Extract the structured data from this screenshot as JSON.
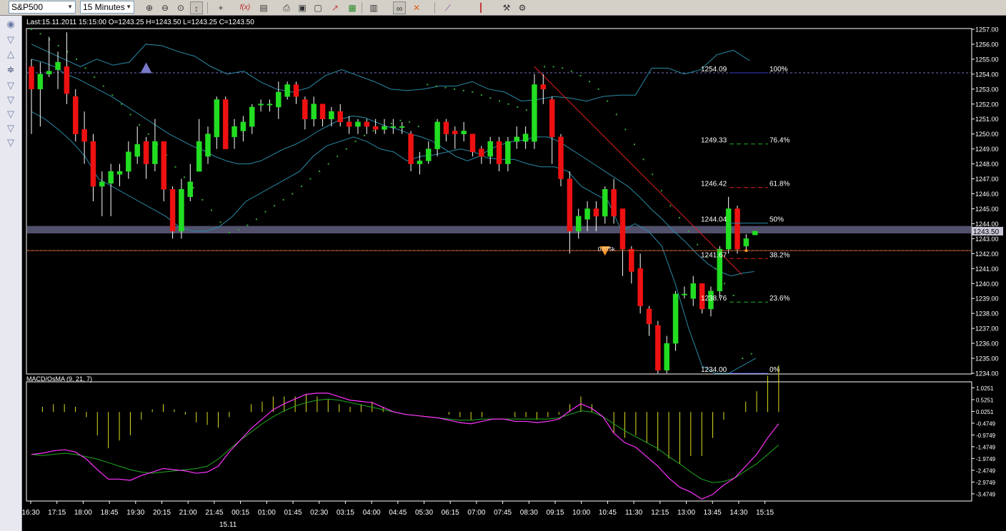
{
  "toolbar": {
    "symbol": "S&P500",
    "timeframe": "15 Minutes",
    "icons": [
      "zoom-in-icon",
      "zoom-out-icon",
      "zoom-fit-icon",
      "cursor-icon",
      "crosshair-icon",
      "function-icon",
      "template-icon",
      "print-icon",
      "save-icon",
      "document-icon",
      "chart-icon",
      "image-icon",
      "grid-icon",
      "link-icon",
      "delete-icon",
      "line-icon",
      "bars-icon",
      "settings-icon",
      "properties-icon"
    ]
  },
  "info_line": "Last:15.11.2011 15:15:00 O=1243.25 H=1243.50 L=1243.25 C=1243.50",
  "macd_label": "MACD/OsMA (9, 21, 7)",
  "date_label": "15.11",
  "price_marker": "1243.50",
  "colors": {
    "background": "#000000",
    "bull": "#22dd22",
    "bear": "#ee1111",
    "bollinger": "#2a8aa6",
    "sar": "#33aa33",
    "macd": "#ff33ff",
    "signal": "#22aa22",
    "histogram": "#dddd22",
    "fib_line": "#dd2222",
    "support_band": "#5a5a78"
  },
  "chart_data": [
    {
      "type": "candlestick",
      "y_axis": {
        "min": 1234.0,
        "max": 1257.0,
        "ticks": [
          "1234.00",
          "1235.00",
          "1236.00",
          "1237.00",
          "1238.00",
          "1239.00",
          "1240.00",
          "1241.00",
          "1242.00",
          "1243.00",
          "1244.00",
          "1245.00",
          "1246.00",
          "1247.00",
          "1248.00",
          "1249.00",
          "1250.00",
          "1251.00",
          "1252.00",
          "1253.00",
          "1254.00",
          "1255.00",
          "1256.00",
          "1257.00"
        ]
      },
      "x_ticks": [
        "16:30",
        "17:15",
        "18:00",
        "18:45",
        "19:30",
        "20:15",
        "21:00",
        "21:45",
        "00:15",
        "01:00",
        "01:45",
        "02:30",
        "03:15",
        "04:00",
        "04:45",
        "05:30",
        "06:15",
        "07:00",
        "07:45",
        "08:30",
        "09:15",
        "10:00",
        "10:45",
        "11:30",
        "12:15",
        "13:00",
        "13:45",
        "14:30",
        "15:15"
      ],
      "candles": [
        [
          1254.5,
          1253.0,
          1255.0,
          1250.0
        ],
        [
          1253.0,
          1254.0,
          1254.8,
          1250.5
        ],
        [
          1254.0,
          1254.2,
          1256.5,
          1253.8
        ],
        [
          1254.3,
          1254.8,
          1255.5,
          1253.0
        ],
        [
          1254.5,
          1252.7,
          1256.8,
          1252.0
        ],
        [
          1252.5,
          1250.0,
          1253.0,
          1249.5
        ],
        [
          1250.3,
          1249.5,
          1251.5,
          1248.0
        ],
        [
          1249.5,
          1246.5,
          1250.0,
          1245.5
        ],
        [
          1246.5,
          1246.8,
          1247.5,
          1244.5
        ],
        [
          1246.7,
          1247.5,
          1248.0,
          1244.5
        ],
        [
          1247.3,
          1247.5,
          1248.0,
          1246.5
        ],
        [
          1247.5,
          1248.8,
          1249.5,
          1247.0
        ],
        [
          1248.5,
          1249.3,
          1250.5,
          1248.0
        ],
        [
          1249.5,
          1248.0,
          1249.8,
          1247.0
        ],
        [
          1248.0,
          1249.5,
          1251.0,
          1247.5
        ],
        [
          1249.5,
          1246.3,
          1249.5,
          1245.5
        ],
        [
          1246.3,
          1243.5,
          1246.5,
          1243.0
        ],
        [
          1243.5,
          1246.3,
          1247.0,
          1243.0
        ],
        [
          1245.8,
          1246.8,
          1248.0,
          1245.5
        ],
        [
          1247.5,
          1249.5,
          1251.0,
          1247.5
        ],
        [
          1248.5,
          1250.0,
          1250.5,
          1248.0
        ],
        [
          1249.8,
          1252.3,
          1252.5,
          1249.0
        ],
        [
          1252.3,
          1249.0,
          1252.5,
          1249.0
        ],
        [
          1249.8,
          1250.5,
          1251.0,
          1249.0
        ],
        [
          1250.2,
          1250.8,
          1251.2,
          1249.5
        ],
        [
          1250.5,
          1251.8,
          1252.0,
          1250.0
        ],
        [
          1252.0,
          1252.0,
          1252.3,
          1251.5
        ],
        [
          1252.0,
          1252.0,
          1252.3,
          1251.5
        ],
        [
          1251.8,
          1252.8,
          1253.5,
          1251.0
        ],
        [
          1252.5,
          1253.3,
          1253.5,
          1252.3
        ],
        [
          1253.3,
          1252.5,
          1253.5,
          1252.0
        ],
        [
          1252.3,
          1251.0,
          1252.5,
          1250.3
        ],
        [
          1251.0,
          1252.0,
          1252.5,
          1250.5
        ],
        [
          1252.0,
          1251.0,
          1252.0,
          1250.5
        ],
        [
          1251.0,
          1251.5,
          1251.8,
          1250.5
        ],
        [
          1251.5,
          1250.8,
          1252.0,
          1250.5
        ],
        [
          1250.8,
          1250.5,
          1251.2,
          1250.0
        ],
        [
          1250.5,
          1250.8,
          1251.0,
          1250.0
        ],
        [
          1250.8,
          1250.5,
          1251.0,
          1250.0
        ],
        [
          1250.5,
          1250.3,
          1251.0,
          1250.0
        ],
        [
          1250.3,
          1250.5,
          1251.0,
          1250.0
        ],
        [
          1250.5,
          1250.5,
          1251.0,
          1250.0
        ],
        [
          1250.5,
          1250.5,
          1250.8,
          1250.0
        ],
        [
          1250.0,
          1248.0,
          1250.2,
          1247.5
        ],
        [
          1248.0,
          1248.2,
          1248.8,
          1247.3
        ],
        [
          1248.2,
          1249.0,
          1249.5,
          1248.0
        ],
        [
          1249.0,
          1250.8,
          1251.0,
          1248.5
        ],
        [
          1250.8,
          1250.0,
          1251.0,
          1249.5
        ],
        [
          1250.2,
          1250.0,
          1250.5,
          1249.0
        ],
        [
          1250.0,
          1250.2,
          1250.8,
          1249.5
        ],
        [
          1250.0,
          1248.8,
          1250.0,
          1248.5
        ],
        [
          1249.0,
          1248.5,
          1249.2,
          1248.0
        ],
        [
          1248.5,
          1249.5,
          1249.8,
          1248.0
        ],
        [
          1249.5,
          1248.0,
          1249.8,
          1247.5
        ],
        [
          1248.0,
          1249.5,
          1249.8,
          1247.5
        ],
        [
          1249.5,
          1249.8,
          1250.5,
          1249.0
        ],
        [
          1249.5,
          1250.0,
          1250.5,
          1249.0
        ],
        [
          1249.5,
          1253.3,
          1254.0,
          1249.0
        ],
        [
          1253.3,
          1253.0,
          1254.0,
          1252.0
        ],
        [
          1252.3,
          1249.8,
          1252.5,
          1248.0
        ],
        [
          1249.8,
          1247.0,
          1250.0,
          1246.5
        ],
        [
          1247.0,
          1243.5,
          1247.5,
          1242.0
        ],
        [
          1243.5,
          1244.5,
          1245.0,
          1243.0
        ],
        [
          1244.3,
          1245.0,
          1245.5,
          1243.5
        ],
        [
          1245.0,
          1244.5,
          1245.5,
          1243.5
        ],
        [
          1244.5,
          1246.3,
          1246.5,
          1244.0
        ],
        [
          1246.3,
          1244.5,
          1247.0,
          1244.0
        ],
        [
          1245.0,
          1242.3,
          1245.0,
          1240.5
        ],
        [
          1242.3,
          1240.8,
          1242.5,
          1240.0
        ],
        [
          1241.0,
          1238.5,
          1242.0,
          1238.0
        ],
        [
          1238.3,
          1237.3,
          1238.5,
          1236.5
        ],
        [
          1237.2,
          1234.2,
          1237.5,
          1234.0
        ],
        [
          1234.2,
          1236.0,
          1236.5,
          1234.0
        ],
        [
          1236.0,
          1239.3,
          1239.5,
          1235.5
        ],
        [
          1239.3,
          1239.3,
          1239.8,
          1239.0
        ],
        [
          1239.0,
          1240.0,
          1240.5,
          1238.5
        ],
        [
          1240.0,
          1238.3,
          1240.0,
          1238.0
        ],
        [
          1238.3,
          1239.5,
          1239.8,
          1237.8
        ],
        [
          1239.5,
          1242.3,
          1242.5,
          1239.0
        ],
        [
          1242.3,
          1245.0,
          1245.8,
          1242.0
        ],
        [
          1245.0,
          1242.3,
          1245.2,
          1242.0
        ],
        [
          1242.5,
          1243.0,
          1243.3,
          1242.3
        ],
        [
          1243.25,
          1243.5,
          1243.5,
          1243.25
        ]
      ],
      "bollinger_upper": [
        1256.0,
        1255.5,
        1255.0,
        1254.5,
        1255.0,
        1254.6,
        1254.8,
        1256.0,
        1255.9,
        1255.5,
        1255.2,
        1254.5,
        1254.0,
        1254.2,
        1253.5,
        1253.0,
        1252.8,
        1253.1,
        1253.9,
        1254.3,
        1253.9,
        1253.5,
        1253.0,
        1252.9,
        1253.0,
        1253.2,
        1253.2,
        1253.5,
        1253.0,
        1252.8,
        1252.2,
        1252.3,
        1252.5,
        1252.4,
        1252.2,
        1252.5,
        1252.6,
        1252.6,
        1254.4,
        1254.4,
        1254.0,
        1254.3,
        1255.3,
        1255.6,
        1254.9
      ],
      "bollinger_mid": [
        1255.0,
        1254.8,
        1254.5,
        1254.0,
        1253.7,
        1253.3,
        1252.9,
        1252.5,
        1252.0,
        1251.5,
        1251.0,
        1250.5,
        1250.0,
        1249.6,
        1249.2,
        1248.9,
        1248.5,
        1248.2,
        1248.0,
        1248.0,
        1248.2,
        1248.6,
        1249.0,
        1249.3,
        1249.7,
        1250.2,
        1250.6,
        1251.0,
        1251.2,
        1251.1,
        1250.8,
        1250.5,
        1250.3,
        1250.0,
        1249.8,
        1249.5,
        1249.0,
        1248.5,
        1248.2,
        1248.5,
        1249.0,
        1249.3,
        1249.5,
        1249.6,
        1249.8,
        1249.8,
        1249.5,
        1249.0,
        1248.5,
        1248.0,
        1247.5,
        1247.0,
        1246.5,
        1245.8,
        1245.0,
        1244.3,
        1243.5,
        1242.8,
        1242.0,
        1241.3,
        1240.8,
        1240.5,
        1240.7,
        1240.8
      ],
      "bollinger_lower": [
        1251.5,
        1251.0,
        1250.3,
        1249.5,
        1248.5,
        1247.0,
        1246.5,
        1246.0,
        1245.5,
        1245.0,
        1244.5,
        1243.8,
        1243.5,
        1243.5,
        1243.8,
        1244.5,
        1245.5,
        1246.0,
        1246.5,
        1247.0,
        1247.5,
        1248.5,
        1249.2,
        1249.5,
        1249.8,
        1249.5,
        1249.0,
        1248.8,
        1248.2,
        1248.5,
        1248.6,
        1248.8,
        1249.0,
        1248.8,
        1248.4,
        1248.3,
        1248.3,
        1248.0,
        1247.8,
        1247.8,
        1247.5,
        1246.5,
        1246.0,
        1245.5,
        1243.5,
        1244.0,
        1243.5,
        1242.5,
        1240.0,
        1237.0,
        1234.5,
        1234.0,
        1234.0,
        1234.5,
        1235.0
      ],
      "sar": [
        1257.0,
        1256.7,
        1256.3,
        1255.9,
        1255.5,
        1255.0,
        1254.4,
        1253.8,
        1253.2,
        1252.6,
        1252.0,
        1251.3,
        1250.6,
        1250.0,
        1249.3,
        1248.6,
        1247.8,
        1247.1,
        1246.4,
        1245.6,
        1244.9,
        1244.1,
        1243.4,
        1243.6,
        1243.9,
        1244.3,
        1244.8,
        1245.2,
        1245.6,
        1246.0,
        1246.5,
        1247.0,
        1247.5,
        1248.0,
        1248.5,
        1249.0,
        1249.5,
        1249.9,
        1250.2,
        1250.5,
        1250.7,
        1250.9,
        1250.8,
        1250.5,
        1253.3,
        1253.2,
        1253.1,
        1253.0,
        1252.9,
        1252.8,
        1252.6,
        1252.4,
        1252.2,
        1252.0,
        1251.8,
        1251.6,
        1251.2,
        1254.5,
        1254.5,
        1254.4,
        1254.2,
        1253.9,
        1253.5,
        1253.0,
        1252.2,
        1251.3,
        1250.3,
        1249.3,
        1248.3,
        1247.3,
        1246.2,
        1245.2,
        1244.4,
        1243.5,
        1242.6,
        1241.8,
        1241.0,
        1240.0,
        1239.2,
        1235.0,
        1235.3
      ],
      "levels": [
        {
          "price": 1254.09,
          "label": "1254.09"
        },
        {
          "price": 1242.2,
          "label": "1242.20"
        }
      ],
      "fibonacci": [
        {
          "price": 1254.09,
          "label": "1254.09",
          "pct": "100%"
        },
        {
          "price": 1249.33,
          "label": "1249.33",
          "pct": "76.4%"
        },
        {
          "price": 1246.42,
          "label": "1246.42",
          "pct": "61.8%"
        },
        {
          "price": 1244.04,
          "label": "1244.04",
          "pct": "50%"
        },
        {
          "price": 1241.67,
          "label": "1241.67",
          "pct": "38.2%"
        },
        {
          "price": 1238.76,
          "label": "1238.76",
          "pct": "23.6%"
        },
        {
          "price": 1234.0,
          "label": "1234.00",
          "pct": "0%"
        }
      ],
      "support_band": {
        "low": 1243.4,
        "high": 1243.8
      },
      "markers": [
        {
          "type": "triangle-up",
          "index": 13,
          "price": 1254.4,
          "label": ""
        },
        {
          "type": "triangle-down",
          "index": 65,
          "price": 1242.2,
          "label": "0.075k"
        }
      ]
    },
    {
      "type": "macd",
      "title": "MACD/OsMA (9, 21, 7)",
      "y_axis": {
        "min": -3.75,
        "max": 1.25,
        "ticks": [
          "1.0251",
          "0.5251",
          "0.0251",
          "-0.4749",
          "-0.9749",
          "-1.4749",
          "-1.9749",
          "-2.4749",
          "-2.9749",
          "-3.4749"
        ]
      },
      "macd": [
        -1.8,
        -1.75,
        -1.65,
        -1.6,
        -1.7,
        -2.0,
        -2.45,
        -2.85,
        -2.85,
        -2.9,
        -2.7,
        -2.55,
        -2.4,
        -2.45,
        -2.5,
        -2.6,
        -2.55,
        -2.3,
        -1.7,
        -1.2,
        -0.7,
        -0.3,
        0.1,
        0.35,
        0.55,
        0.75,
        0.8,
        0.8,
        0.65,
        0.5,
        0.45,
        0.4,
        0.2,
        0.0,
        -0.1,
        -0.15,
        -0.2,
        -0.25,
        -0.35,
        -0.45,
        -0.5,
        -0.4,
        -0.3,
        -0.3,
        -0.4,
        -0.4,
        -0.45,
        -0.4,
        -0.3,
        0.05,
        0.35,
        0.15,
        -0.2,
        -0.9,
        -1.3,
        -1.5,
        -1.9,
        -2.3,
        -2.8,
        -3.2,
        -3.4,
        -3.7,
        -3.5,
        -3.1,
        -2.8,
        -2.3,
        -1.8,
        -1.1,
        -0.5
      ],
      "signal": [
        -1.8,
        -1.85,
        -1.8,
        -1.75,
        -1.8,
        -1.9,
        -2.0,
        -2.15,
        -2.3,
        -2.45,
        -2.55,
        -2.6,
        -2.55,
        -2.5,
        -2.45,
        -2.4,
        -2.3,
        -2.0,
        -1.6,
        -1.2,
        -0.85,
        -0.5,
        -0.2,
        0.05,
        0.25,
        0.4,
        0.5,
        0.55,
        0.5,
        0.4,
        0.3,
        0.2,
        0.1,
        0.0,
        -0.1,
        -0.15,
        -0.2,
        -0.25,
        -0.3,
        -0.35,
        -0.35,
        -0.3,
        -0.3,
        -0.3,
        -0.3,
        -0.3,
        -0.3,
        -0.3,
        -0.25,
        -0.1,
        0.05,
        0.0,
        -0.2,
        -0.5,
        -0.8,
        -1.05,
        -1.3,
        -1.55,
        -1.9,
        -2.2,
        -2.55,
        -2.85,
        -3.0,
        -2.95,
        -2.8,
        -2.5,
        -2.2,
        -1.8,
        -1.4
      ]
    }
  ]
}
